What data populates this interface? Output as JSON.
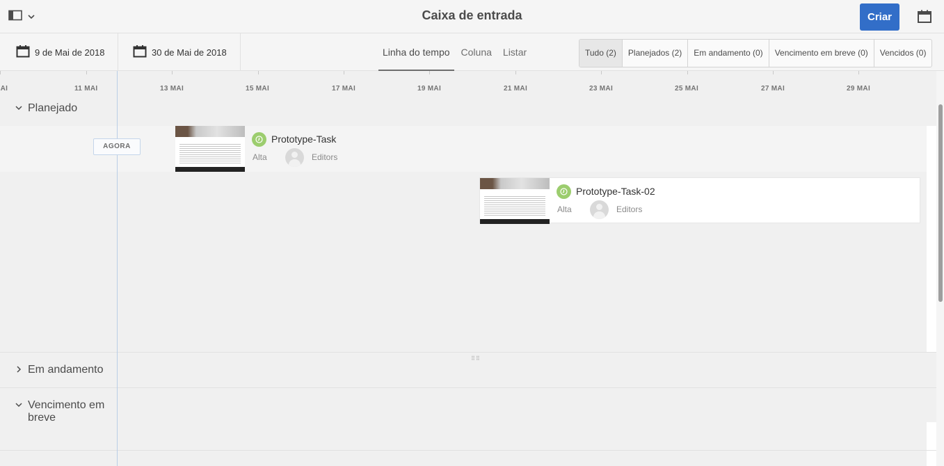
{
  "header": {
    "title": "Caixa de entrada",
    "create_label": "Criar"
  },
  "toolbar": {
    "start_date": "9 de Mai de 2018",
    "end_date": "30 de Mai de 2018",
    "views": [
      "Linha do tempo",
      "Coluna",
      "Listar"
    ],
    "active_view": "Linha do tempo",
    "filters": [
      {
        "label": "Tudo (2)",
        "selected": true
      },
      {
        "label": "Planejados (2)",
        "selected": false
      },
      {
        "label": "Em andamento (0)",
        "selected": false
      },
      {
        "label": "Vencimento em breve (0)",
        "selected": false
      },
      {
        "label": "Vencidos (0)",
        "selected": false
      }
    ]
  },
  "timeline": {
    "ticks": [
      "MAI",
      "11 MAI",
      "13 MAI",
      "15 MAI",
      "17 MAI",
      "19 MAI",
      "21 MAI",
      "23 MAI",
      "25 MAI",
      "27 MAI",
      "29 MAI"
    ],
    "now_label": "AGORA",
    "groups": [
      {
        "label": "Planejado",
        "expanded": true
      },
      {
        "label": "Em andamento",
        "expanded": false
      },
      {
        "label": "Vencimento em breve",
        "expanded": true
      }
    ],
    "tasks": [
      {
        "name": "Prototype-Task",
        "priority": "Alta",
        "assignee": "Editors",
        "status_color": "#9ccd6e"
      },
      {
        "name": "Prototype-Task-02",
        "priority": "Alta",
        "assignee": "Editors",
        "status_color": "#9ccd6e"
      }
    ]
  },
  "icons": {
    "rail_toggle": "sidebar-panel-icon",
    "dropdown": "chevron-down-icon",
    "calendar": "calendar-icon",
    "status": "clock-icon",
    "avatar": "user-avatar-icon"
  },
  "colors": {
    "accent": "#326ec8",
    "now_line": "#b9cde6",
    "status_green": "#9ccd6e"
  }
}
